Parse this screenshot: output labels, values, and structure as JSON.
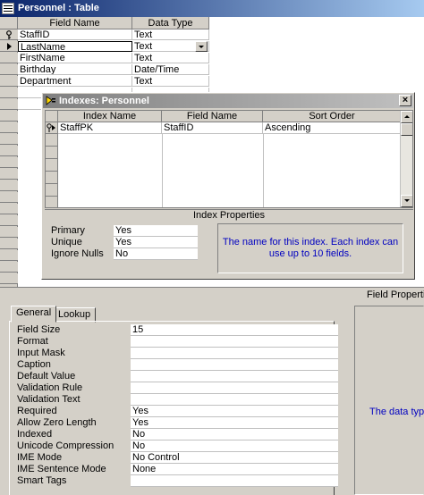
{
  "window": {
    "title": "Personnel : Table"
  },
  "grid": {
    "headers": {
      "field_name": "Field Name",
      "data_type": "Data Type"
    },
    "rows": [
      {
        "field_name": "StaffID",
        "data_type": "Text"
      },
      {
        "field_name": "LastName",
        "data_type": "Text"
      },
      {
        "field_name": "FirstName",
        "data_type": "Text"
      },
      {
        "field_name": "Birthday",
        "data_type": "Date/Time"
      },
      {
        "field_name": "Department",
        "data_type": "Text"
      }
    ]
  },
  "indexes": {
    "title": "Indexes: Personnel",
    "close_label": "×",
    "headers": {
      "index_name": "Index Name",
      "field_name": "Field Name",
      "sort_order": "Sort Order"
    },
    "rows": [
      {
        "index_name": "StaffPK",
        "field_name": "StaffID",
        "sort_order": "Ascending"
      }
    ],
    "properties_title": "Index Properties",
    "properties": [
      {
        "label": "Primary",
        "value": "Yes"
      },
      {
        "label": "Unique",
        "value": "Yes"
      },
      {
        "label": "Ignore Nulls",
        "value": "No"
      }
    ],
    "help_text": "The name for this index.  Each index can use up to 10 fields."
  },
  "field_properties": {
    "label": "Field Properties",
    "tabs": [
      {
        "label": "General"
      },
      {
        "label": "Lookup"
      }
    ],
    "rows": [
      {
        "label": "Field Size",
        "value": "15"
      },
      {
        "label": "Format",
        "value": ""
      },
      {
        "label": "Input Mask",
        "value": ""
      },
      {
        "label": "Caption",
        "value": ""
      },
      {
        "label": "Default Value",
        "value": ""
      },
      {
        "label": "Validation Rule",
        "value": ""
      },
      {
        "label": "Validation Text",
        "value": ""
      },
      {
        "label": "Required",
        "value": "Yes"
      },
      {
        "label": "Allow Zero Length",
        "value": "Yes"
      },
      {
        "label": "Indexed",
        "value": "No"
      },
      {
        "label": "Unicode Compression",
        "value": "No"
      },
      {
        "label": "IME Mode",
        "value": "No Control"
      },
      {
        "label": "IME Sentence Mode",
        "value": "None"
      },
      {
        "label": "Smart Tags",
        "value": ""
      }
    ],
    "side_help": "The data type"
  }
}
